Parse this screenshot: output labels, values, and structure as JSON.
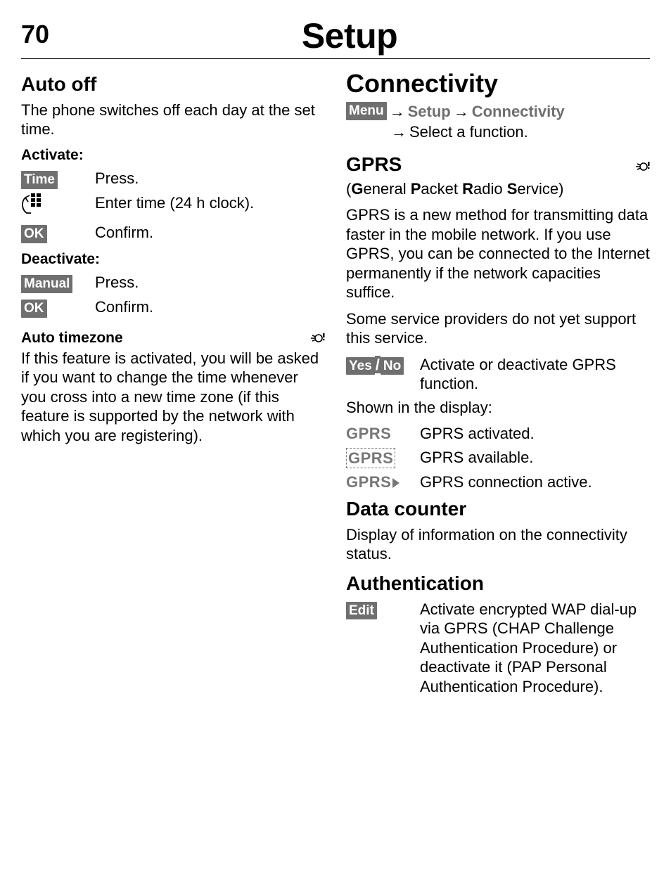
{
  "page": {
    "number": "70",
    "title": "Setup"
  },
  "left": {
    "auto_off": {
      "heading": "Auto off",
      "intro": "The phone switches off each day at the set time.",
      "activate_label": "Activate:",
      "time_key": "Time",
      "time_desc": "Press.",
      "enter_time_desc": "Enter time (24 h clock).",
      "ok_key": "OK",
      "ok_desc": "Confirm.",
      "deactivate_label": "Deactivate:",
      "manual_key": "Manual",
      "manual_desc": "Press.",
      "ok2_desc": "Confirm."
    },
    "auto_tz": {
      "heading": "Auto timezone",
      "body": "If this feature is activated, you will be asked if you want to change the time whenever you cross into a new time zone (if this feature is supported by the network with which you are registering)."
    }
  },
  "right": {
    "connectivity": {
      "heading": "Connectivity",
      "menu_key": "Menu",
      "path1": "Setup",
      "path2": "Connectivity",
      "path3": "Select a function."
    },
    "gprs": {
      "heading": "GPRS",
      "expansion_pre": "(",
      "expansion_g": "G",
      "expansion_1": "eneral ",
      "expansion_p": "P",
      "expansion_2": "acket ",
      "expansion_r": "R",
      "expansion_3": "adio ",
      "expansion_s": "S",
      "expansion_4": "ervice)",
      "body1": "GPRS is a new method for transmitting data faster in the mobile network. If you use GPRS, you can be connected to the Internet permanently if the network capacities suffice.",
      "body2": "Some service providers do not yet support this service.",
      "yes_key": "Yes",
      "no_key": "No",
      "yesno_desc": "Activate or deactivate GPRS function.",
      "shown": "Shown in the display:",
      "st1_lbl": "GPRS",
      "st1_desc": "GPRS activated.",
      "st2_lbl": "GPRS",
      "st2_desc": "GPRS available.",
      "st3_lbl": "GPRS",
      "st3_desc": "GPRS connection active."
    },
    "data_counter": {
      "heading": "Data counter",
      "body": "Display of information on the connectivity status."
    },
    "auth": {
      "heading": "Authentication",
      "edit_key": "Edit",
      "desc": "Activate encrypted WAP dial-up via GPRS (CHAP Challenge Authentication Procedure) or deactivate it (PAP Personal Authentication Procedure)."
    }
  }
}
